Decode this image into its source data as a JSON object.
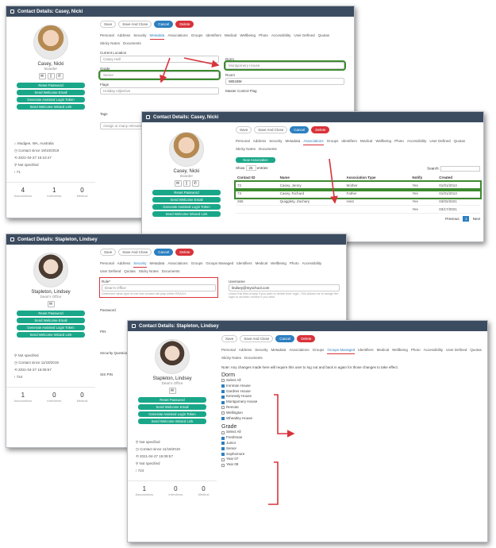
{
  "w1": {
    "title": "Contact Details: Casey, Nicki",
    "name": "Casey, Nicki",
    "role": "Boarder",
    "info": [
      "Mudgee, WA, Australia",
      "Contact since 19/10/2019",
      "2021-04-27 15:10:47",
      "Not specified",
      "71"
    ],
    "stats": [
      {
        "n": "4",
        "l": "Associations"
      },
      {
        "n": "1",
        "l": "Interviews"
      },
      {
        "n": "0",
        "l": "Medical"
      }
    ],
    "labels": {
      "current_location": "Current Location",
      "current_location_value": "Casey Hall",
      "dorm": "Dorm",
      "dorm_value": "Montgomery House",
      "grade": "Grade",
      "grade_value": "Senior",
      "room": "Room",
      "room_value": "WB1BM",
      "flags": "Flags",
      "flags_value": "Holiday Adjective",
      "master": "Master Control Flag",
      "tags": "Tags",
      "tags_value": "Assign or many relevant tags"
    }
  },
  "w2": {
    "title": "Contact Details: Casey, Nicki",
    "name": "Casey, Nicki",
    "role": "Boarder",
    "new_assoc": "New Association",
    "show": "Show",
    "entries": "entries",
    "show_n": "25",
    "search": "Search:",
    "cols": [
      "Contact ID",
      "Name",
      "Association Type",
      "Notify",
      "Created"
    ],
    "rows": [
      [
        "72",
        "Casey, Jenny",
        "Mother",
        "Yes",
        "01/01/2013"
      ],
      [
        "73",
        "Casey, Richard",
        "Father",
        "Yes",
        "01/01/2013"
      ],
      [
        "265",
        "Quigglety, Zachary",
        "Host",
        "Yes",
        "03/02/2021"
      ],
      [
        "",
        "",
        "",
        "Yes",
        "03/17/2021"
      ]
    ],
    "prev": "Previous",
    "page": "1",
    "next": "Next"
  },
  "w3": {
    "title": "Contact Details: Stapleton, Lindsey",
    "name": "Stapleton, Lindsey",
    "role": "Dean's Office",
    "role_label": "Role*",
    "role_value": "Dean's Office",
    "username_label": "Username",
    "username_value": "lindsey@myschool.com",
    "role_help": "Determine what type of role this contact will play within REACH.",
    "user_help": "Leave this field empty if you wish to delete their login. This allows me to assign the login to another contact if you wish.",
    "pwd": "Password",
    "pin": "PIN",
    "sq": "Security Question",
    "sis": "SIS PIN",
    "info": [
      "Not specified",
      "Contact since 11/18/2019",
      "2021-04-27 15:09:57",
      "Not specified",
      "724"
    ],
    "stats": [
      {
        "n": "1",
        "l": "Associations"
      },
      {
        "n": "0",
        "l": "Interviews"
      },
      {
        "n": "0",
        "l": "Medical"
      }
    ]
  },
  "w4": {
    "title": "Contact Details: Stapleton, Lindsey",
    "name": "Stapleton, Lindsey",
    "role": "Dean's Office",
    "note": "Note: Any changes made here will require this user to log out and back in again for those changes to take effect.",
    "dorm": "Dorm",
    "dorm_items": [
      {
        "l": "Select All",
        "c": false
      },
      {
        "l": "Ironman House",
        "c": true
      },
      {
        "l": "Gardner House",
        "c": true
      },
      {
        "l": "Kennedy House",
        "c": true
      },
      {
        "l": "Montgomery House",
        "c": true
      },
      {
        "l": "Remote",
        "c": false
      },
      {
        "l": "Wellington",
        "c": false
      },
      {
        "l": "Wheatley House",
        "c": true
      }
    ],
    "grade": "Grade",
    "grade_items": [
      {
        "l": "Select All",
        "c": false
      },
      {
        "l": "Freshman",
        "c": true
      },
      {
        "l": "Junior",
        "c": true
      },
      {
        "l": "Senior",
        "c": true
      },
      {
        "l": "Sophomore",
        "c": true
      },
      {
        "l": "Year 07",
        "c": false
      },
      {
        "l": "Year 08",
        "c": false
      }
    ],
    "info": [
      "Not specified",
      "Contact since 11/18/2019",
      "2021-04-27 15:09:57",
      "Not specified",
      "724"
    ],
    "stats": [
      {
        "n": "1",
        "l": "Associations"
      },
      {
        "n": "0",
        "l": "Interviews"
      },
      {
        "n": "0",
        "l": "Medical"
      }
    ]
  },
  "buttons": [
    "Reset Password",
    "Send Welcome Email",
    "Generate Assisted Login Token",
    "Send Welcome Wizard Link"
  ],
  "toolbar": {
    "save": "Save",
    "save_close": "Save And Close",
    "cancel": "Cancel",
    "delete": "Delete"
  },
  "tabs1": [
    "Personal",
    "Address",
    "Security",
    "Metadata",
    "Associations",
    "Groups",
    "Identifiers",
    "Medical",
    "Wellbeing",
    "Photo",
    "Accessibility",
    "User Defined",
    "Quotas",
    "Sticky Notes",
    "Documents"
  ],
  "tabs2": [
    "Personal",
    "Address",
    "Security",
    "Metadata",
    "Associations",
    "Groups Managed",
    "Identifiers",
    "Medical",
    "Wellbeing",
    "Photo",
    "Accessibility",
    "User Defined",
    "Quotas",
    "Sticky Notes",
    "Documents"
  ],
  "colors": {
    "titlebar": "#3c4c60",
    "green": "#1aa789",
    "blue": "#2d7fc0",
    "red": "#d8333b",
    "highlight_green": "#3c8a2e"
  }
}
